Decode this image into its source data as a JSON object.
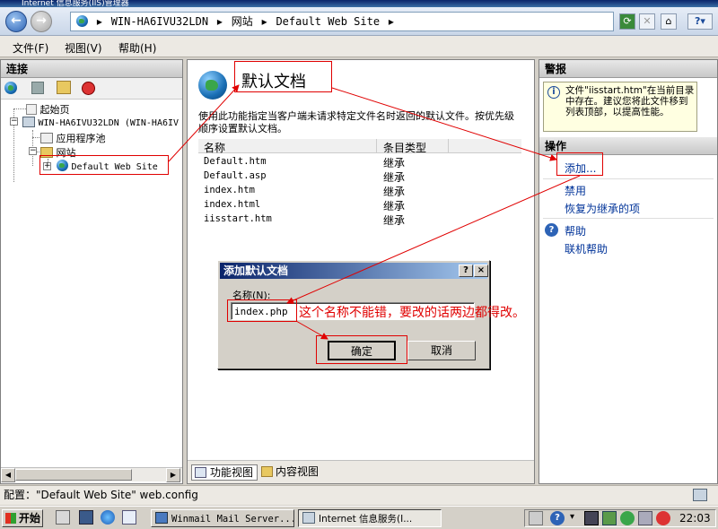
{
  "window": {
    "title": "Internet 信息服务(IIS)管理器"
  },
  "address": {
    "server": "WIN-HA6IVU32LDN",
    "sites": "网站",
    "site": "Default Web Site"
  },
  "menu": {
    "file": "文件(F)",
    "view": "视图(V)",
    "help": "帮助(H)"
  },
  "connections": {
    "header": "连接",
    "tree": {
      "start_page": "起始页",
      "server": "WIN-HA6IVU32LDN (WIN-HA6IV",
      "app_pools": "应用程序池",
      "sites": "网站",
      "default_site": "Default Web Site"
    }
  },
  "feature": {
    "title": "默认文档",
    "description": "使用此功能指定当客户端未请求特定文件名时返回的默认文件。按优先级顺序设置默认文档。",
    "columns": {
      "name": "名称",
      "entry_type": "条目类型"
    },
    "rows": [
      {
        "name": "Default.htm",
        "type": "继承"
      },
      {
        "name": "Default.asp",
        "type": "继承"
      },
      {
        "name": "index.htm",
        "type": "继承"
      },
      {
        "name": "index.html",
        "type": "继承"
      },
      {
        "name": "iisstart.htm",
        "type": "继承"
      }
    ],
    "tabs": {
      "features_view": "功能视图",
      "content_view": "内容视图"
    }
  },
  "alerts": {
    "header": "警报",
    "message": "文件\"iisstart.htm\"在当前目录中存在。建议您将此文件移到列表顶部，以提高性能。"
  },
  "actions": {
    "header": "操作",
    "add": "添加...",
    "disable": "禁用",
    "revert": "恢复为继承的项",
    "help": "帮助",
    "online_help": "联机帮助"
  },
  "dialog": {
    "title": "添加默认文档",
    "help_btn": "?",
    "close_btn": "×",
    "name_label": "名称(N):",
    "name_value": "index.php",
    "ok": "确定",
    "cancel": "取消"
  },
  "annotation": {
    "note": "这个名称不能错，要改的话两边都得改。"
  },
  "status": {
    "text": "配置：\"Default Web Site\" web.config"
  },
  "taskbar": {
    "start": "开始",
    "task1": "Winmail Mail Server...",
    "task2": "Internet 信息服务(I...",
    "clock": "22:03"
  },
  "colors": {
    "annotation": "#e00000",
    "link": "#003399",
    "accent": "#0a246a"
  }
}
